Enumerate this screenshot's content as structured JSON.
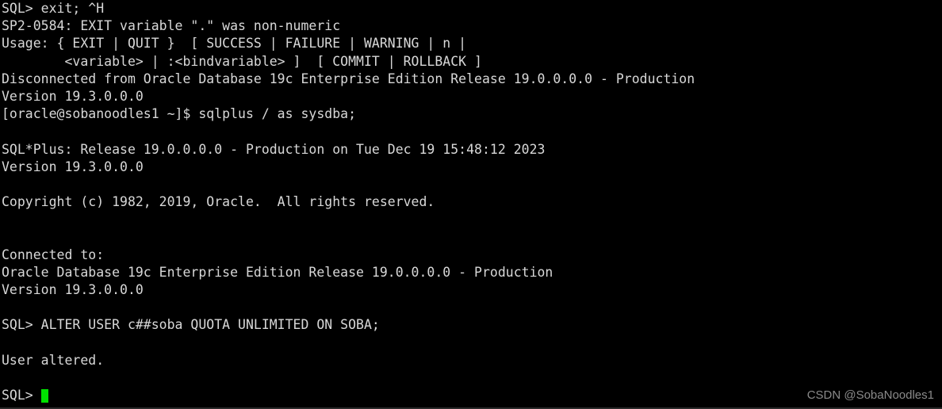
{
  "terminal": {
    "colors": {
      "background": "#000000",
      "foreground": "#d8d8d8",
      "cursor": "#00e000",
      "watermark": "#8a8a8a"
    },
    "lines": [
      "SQL> exit; ^H",
      "SP2-0584: EXIT variable \".\" was non-numeric",
      "Usage: { EXIT | QUIT }  [ SUCCESS | FAILURE | WARNING | n |",
      "        <variable> | :<bindvariable> ]  [ COMMIT | ROLLBACK ]",
      "Disconnected from Oracle Database 19c Enterprise Edition Release 19.0.0.0.0 - Production",
      "Version 19.3.0.0.0",
      "[oracle@sobanoodles1 ~]$ sqlplus / as sysdba;",
      "",
      "SQL*Plus: Release 19.0.0.0.0 - Production on Tue Dec 19 15:48:12 2023",
      "Version 19.3.0.0.0",
      "",
      "Copyright (c) 1982, 2019, Oracle.  All rights reserved.",
      "",
      "",
      "Connected to:",
      "Oracle Database 19c Enterprise Edition Release 19.0.0.0.0 - Production",
      "Version 19.3.0.0.0",
      "",
      "SQL> ALTER USER c##soba QUOTA UNLIMITED ON SOBA;",
      "",
      "User altered.",
      ""
    ],
    "prompt": {
      "text": "SQL> ",
      "cursor": "block-cursor"
    }
  },
  "watermark": {
    "text": "CSDN @SobaNoodles1"
  }
}
